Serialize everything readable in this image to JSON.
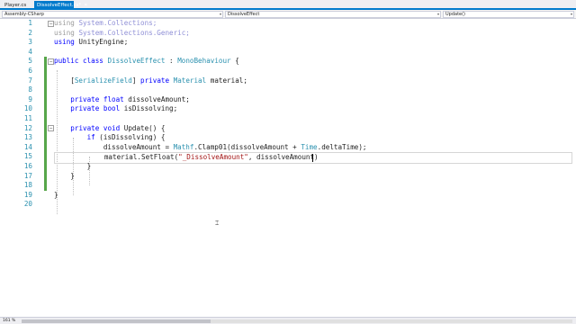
{
  "tabs": [
    {
      "label": "Player.cs",
      "active": false
    },
    {
      "label": "DissolveEffect.cs*",
      "active": true
    }
  ],
  "navbar": {
    "project": "Assembly-CSharp",
    "class": "DissolveEffect",
    "member": "Update()"
  },
  "editor": {
    "lines": [
      {
        "n": "1",
        "tokens": [
          [
            "dimk",
            "using"
          ],
          [
            "pl",
            " "
          ],
          [
            "dim",
            "System.Collections;"
          ]
        ]
      },
      {
        "n": "2",
        "tokens": [
          [
            "dimk",
            "using"
          ],
          [
            "pl",
            " "
          ],
          [
            "dim",
            "System.Collections.Generic;"
          ]
        ]
      },
      {
        "n": "3",
        "tokens": [
          [
            "kw",
            "using"
          ],
          [
            "pl",
            " UnityEngine;"
          ]
        ]
      },
      {
        "n": "4",
        "tokens": []
      },
      {
        "n": "5",
        "tokens": [
          [
            "kw",
            "public class"
          ],
          [
            "pl",
            " "
          ],
          [
            "typ",
            "DissolveEffect"
          ],
          [
            "pl",
            " : "
          ],
          [
            "typ",
            "MonoBehaviour"
          ],
          [
            "pl",
            " {"
          ]
        ]
      },
      {
        "n": "6",
        "tokens": []
      },
      {
        "n": "7",
        "tokens": [
          [
            "pl",
            "    ["
          ],
          [
            "typ",
            "SerializeField"
          ],
          [
            "pl",
            "] "
          ],
          [
            "kw",
            "private"
          ],
          [
            "pl",
            " "
          ],
          [
            "typ",
            "Material"
          ],
          [
            "pl",
            " material;"
          ]
        ]
      },
      {
        "n": "8",
        "tokens": []
      },
      {
        "n": "9",
        "tokens": [
          [
            "pl",
            "    "
          ],
          [
            "kw",
            "private float"
          ],
          [
            "pl",
            " dissolveAmount;"
          ]
        ]
      },
      {
        "n": "10",
        "tokens": [
          [
            "pl",
            "    "
          ],
          [
            "kw",
            "private bool"
          ],
          [
            "pl",
            " isDissolving;"
          ]
        ]
      },
      {
        "n": "11",
        "tokens": []
      },
      {
        "n": "12",
        "tokens": [
          [
            "pl",
            "    "
          ],
          [
            "kw",
            "private void"
          ],
          [
            "pl",
            " Update() {"
          ]
        ]
      },
      {
        "n": "13",
        "tokens": [
          [
            "pl",
            "        "
          ],
          [
            "kw",
            "if"
          ],
          [
            "pl",
            " (isDissolving) {"
          ]
        ]
      },
      {
        "n": "14",
        "tokens": [
          [
            "pl",
            "            dissolveAmount = "
          ],
          [
            "typ",
            "Mathf"
          ],
          [
            "pl",
            ".Clamp01(dissolveAmount + "
          ],
          [
            "typ",
            "Time"
          ],
          [
            "pl",
            ".deltaTime);"
          ]
        ]
      },
      {
        "n": "15",
        "tokens": [
          [
            "pl",
            "            material.SetFloat("
          ],
          [
            "str",
            "\"_DissolveAmount\""
          ],
          [
            "pl",
            ", dissolveAmount)"
          ]
        ]
      },
      {
        "n": "16",
        "tokens": [
          [
            "pl",
            "        }"
          ]
        ]
      },
      {
        "n": "17",
        "tokens": [
          [
            "pl",
            "    }"
          ]
        ]
      },
      {
        "n": "18",
        "tokens": []
      },
      {
        "n": "19",
        "tokens": [
          [
            "pl",
            "}"
          ]
        ]
      },
      {
        "n": "20",
        "tokens": []
      }
    ],
    "changed_lines": [
      "5",
      "6",
      "7",
      "8",
      "9",
      "10",
      "11",
      "12",
      "13",
      "14",
      "15",
      "16",
      "17",
      "18"
    ],
    "fold_lines": [
      "1",
      "5",
      "12"
    ],
    "current_line": "15"
  },
  "statusbar": {
    "zoom": "161 %"
  },
  "colors": {
    "accent": "#007acc",
    "keyword": "#0000ff",
    "type": "#2b91af",
    "string": "#a31515",
    "change_bar": "#57a64a"
  }
}
